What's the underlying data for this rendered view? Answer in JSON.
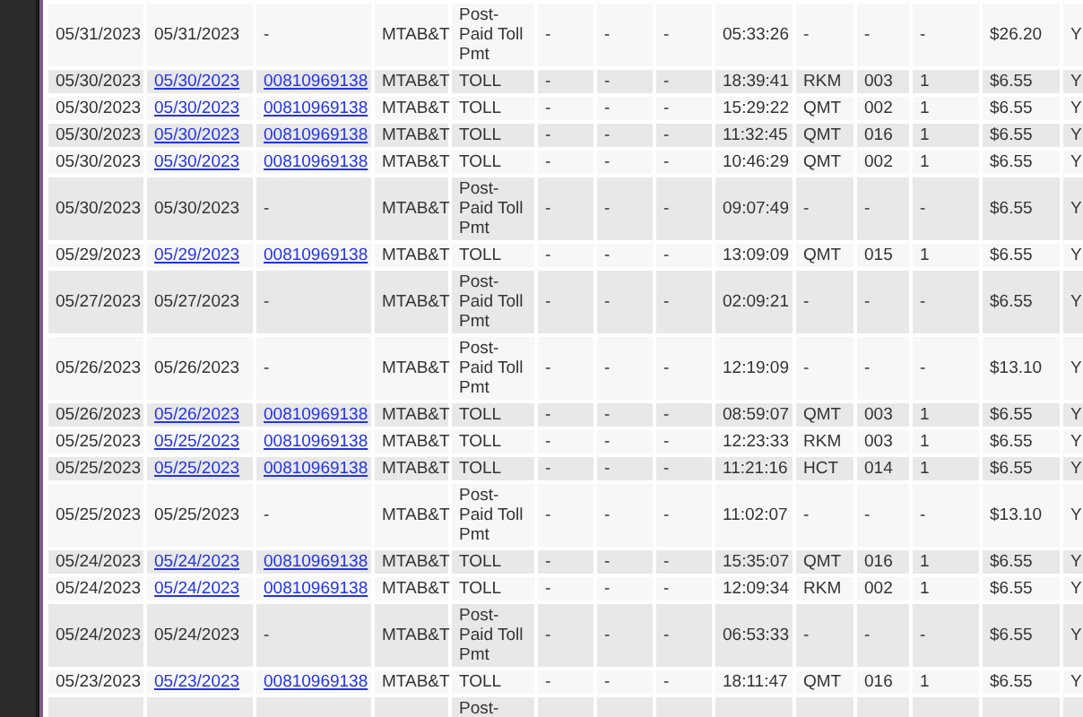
{
  "table": {
    "rows": [
      {
        "linked": false,
        "column_1": "05/31/2023",
        "column_2": "05/31/2023",
        "column_3": "-",
        "column_4": "MTAB&T",
        "column_5": "Post-Paid Toll Pmt",
        "column_6": "-",
        "column_7": "-",
        "column_8": "-",
        "column_9": "05:33:26",
        "column_10": "-",
        "column_11": "-",
        "column_12": "-",
        "column_13": "$26.20",
        "column_14": "Y"
      },
      {
        "linked": true,
        "column_1": "05/30/2023",
        "column_2": "05/30/2023",
        "column_3": "00810969138",
        "column_4": "MTAB&T",
        "column_5": "TOLL",
        "column_6": "-",
        "column_7": "-",
        "column_8": "-",
        "column_9": "18:39:41",
        "column_10": "RKM",
        "column_11": "003",
        "column_12": "1",
        "column_13": "$6.55",
        "column_14": "Y"
      },
      {
        "linked": true,
        "column_1": "05/30/2023",
        "column_2": "05/30/2023",
        "column_3": "00810969138",
        "column_4": "MTAB&T",
        "column_5": "TOLL",
        "column_6": "-",
        "column_7": "-",
        "column_8": "-",
        "column_9": "15:29:22",
        "column_10": "QMT",
        "column_11": "002",
        "column_12": "1",
        "column_13": "$6.55",
        "column_14": "Y"
      },
      {
        "linked": true,
        "column_1": "05/30/2023",
        "column_2": "05/30/2023",
        "column_3": "00810969138",
        "column_4": "MTAB&T",
        "column_5": "TOLL",
        "column_6": "-",
        "column_7": "-",
        "column_8": "-",
        "column_9": "11:32:45",
        "column_10": "QMT",
        "column_11": "016",
        "column_12": "1",
        "column_13": "$6.55",
        "column_14": "Y"
      },
      {
        "linked": true,
        "column_1": "05/30/2023",
        "column_2": "05/30/2023",
        "column_3": "00810969138",
        "column_4": "MTAB&T",
        "column_5": "TOLL",
        "column_6": "-",
        "column_7": "-",
        "column_8": "-",
        "column_9": "10:46:29",
        "column_10": "QMT",
        "column_11": "002",
        "column_12": "1",
        "column_13": "$6.55",
        "column_14": "Y"
      },
      {
        "linked": false,
        "column_1": "05/30/2023",
        "column_2": "05/30/2023",
        "column_3": "-",
        "column_4": "MTAB&T",
        "column_5": "Post-Paid Toll Pmt",
        "column_6": "-",
        "column_7": "-",
        "column_8": "-",
        "column_9": "09:07:49",
        "column_10": "-",
        "column_11": "-",
        "column_12": "-",
        "column_13": "$6.55",
        "column_14": "Y"
      },
      {
        "linked": true,
        "column_1": "05/29/2023",
        "column_2": "05/29/2023",
        "column_3": "00810969138",
        "column_4": "MTAB&T",
        "column_5": "TOLL",
        "column_6": "-",
        "column_7": "-",
        "column_8": "-",
        "column_9": "13:09:09",
        "column_10": "QMT",
        "column_11": "015",
        "column_12": "1",
        "column_13": "$6.55",
        "column_14": "Y"
      },
      {
        "linked": false,
        "column_1": "05/27/2023",
        "column_2": "05/27/2023",
        "column_3": "-",
        "column_4": "MTAB&T",
        "column_5": "Post-Paid Toll Pmt",
        "column_6": "-",
        "column_7": "-",
        "column_8": "-",
        "column_9": "02:09:21",
        "column_10": "-",
        "column_11": "-",
        "column_12": "-",
        "column_13": "$6.55",
        "column_14": "Y"
      },
      {
        "linked": false,
        "column_1": "05/26/2023",
        "column_2": "05/26/2023",
        "column_3": "-",
        "column_4": "MTAB&T",
        "column_5": "Post-Paid Toll Pmt",
        "column_6": "-",
        "column_7": "-",
        "column_8": "-",
        "column_9": "12:19:09",
        "column_10": "-",
        "column_11": "-",
        "column_12": "-",
        "column_13": "$13.10",
        "column_14": "Y"
      },
      {
        "linked": true,
        "column_1": "05/26/2023",
        "column_2": "05/26/2023",
        "column_3": "00810969138",
        "column_4": "MTAB&T",
        "column_5": "TOLL",
        "column_6": "-",
        "column_7": "-",
        "column_8": "-",
        "column_9": "08:59:07",
        "column_10": "QMT",
        "column_11": "003",
        "column_12": "1",
        "column_13": "$6.55",
        "column_14": "Y"
      },
      {
        "linked": true,
        "column_1": "05/25/2023",
        "column_2": "05/25/2023",
        "column_3": "00810969138",
        "column_4": "MTAB&T",
        "column_5": "TOLL",
        "column_6": "-",
        "column_7": "-",
        "column_8": "-",
        "column_9": "12:23:33",
        "column_10": "RKM",
        "column_11": "003",
        "column_12": "1",
        "column_13": "$6.55",
        "column_14": "Y"
      },
      {
        "linked": true,
        "column_1": "05/25/2023",
        "column_2": "05/25/2023",
        "column_3": "00810969138",
        "column_4": "MTAB&T",
        "column_5": "TOLL",
        "column_6": "-",
        "column_7": "-",
        "column_8": "-",
        "column_9": "11:21:16",
        "column_10": "HCT",
        "column_11": "014",
        "column_12": "1",
        "column_13": "$6.55",
        "column_14": "Y"
      },
      {
        "linked": false,
        "column_1": "05/25/2023",
        "column_2": "05/25/2023",
        "column_3": "-",
        "column_4": "MTAB&T",
        "column_5": "Post-Paid Toll Pmt",
        "column_6": "-",
        "column_7": "-",
        "column_8": "-",
        "column_9": "11:02:07",
        "column_10": "-",
        "column_11": "-",
        "column_12": "-",
        "column_13": "$13.10",
        "column_14": "Y"
      },
      {
        "linked": true,
        "column_1": "05/24/2023",
        "column_2": "05/24/2023",
        "column_3": "00810969138",
        "column_4": "MTAB&T",
        "column_5": "TOLL",
        "column_6": "-",
        "column_7": "-",
        "column_8": "-",
        "column_9": "15:35:07",
        "column_10": "QMT",
        "column_11": "016",
        "column_12": "1",
        "column_13": "$6.55",
        "column_14": "Y"
      },
      {
        "linked": true,
        "column_1": "05/24/2023",
        "column_2": "05/24/2023",
        "column_3": "00810969138",
        "column_4": "MTAB&T",
        "column_5": "TOLL",
        "column_6": "-",
        "column_7": "-",
        "column_8": "-",
        "column_9": "12:09:34",
        "column_10": "RKM",
        "column_11": "002",
        "column_12": "1",
        "column_13": "$6.55",
        "column_14": "Y"
      },
      {
        "linked": false,
        "column_1": "05/24/2023",
        "column_2": "05/24/2023",
        "column_3": "-",
        "column_4": "MTAB&T",
        "column_5": "Post-Paid Toll Pmt",
        "column_6": "-",
        "column_7": "-",
        "column_8": "-",
        "column_9": "06:53:33",
        "column_10": "-",
        "column_11": "-",
        "column_12": "-",
        "column_13": "$6.55",
        "column_14": "Y"
      },
      {
        "linked": true,
        "column_1": "05/23/2023",
        "column_2": "05/23/2023",
        "column_3": "00810969138",
        "column_4": "MTAB&T",
        "column_5": "TOLL",
        "column_6": "-",
        "column_7": "-",
        "column_8": "-",
        "column_9": "18:11:47",
        "column_10": "QMT",
        "column_11": "016",
        "column_12": "1",
        "column_13": "$6.55",
        "column_14": "Y"
      },
      {
        "column_5": "Post-"
      }
    ]
  }
}
